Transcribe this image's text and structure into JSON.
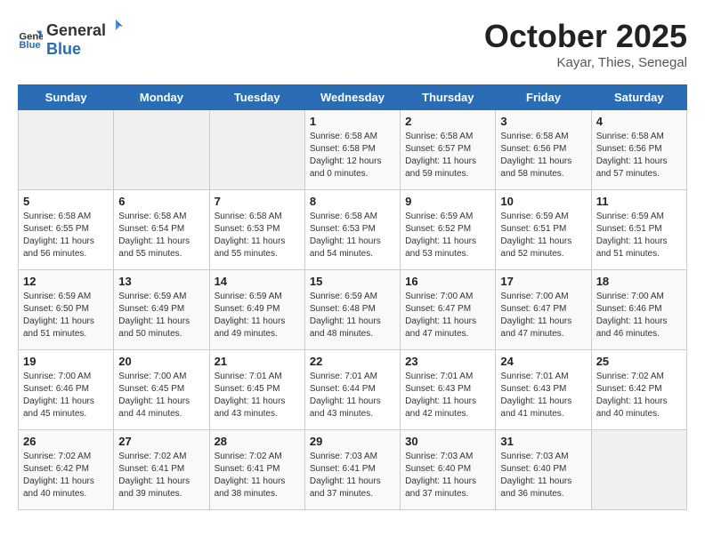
{
  "header": {
    "logo_general": "General",
    "logo_blue": "Blue",
    "title": "October 2025",
    "subtitle": "Kayar, Thies, Senegal"
  },
  "days_of_week": [
    "Sunday",
    "Monday",
    "Tuesday",
    "Wednesday",
    "Thursday",
    "Friday",
    "Saturday"
  ],
  "weeks": [
    [
      {
        "day": "",
        "empty": true
      },
      {
        "day": "",
        "empty": true
      },
      {
        "day": "",
        "empty": true
      },
      {
        "day": "1",
        "sunrise": "6:58 AM",
        "sunset": "6:58 PM",
        "daylight": "12 hours and 0 minutes."
      },
      {
        "day": "2",
        "sunrise": "6:58 AM",
        "sunset": "6:57 PM",
        "daylight": "11 hours and 59 minutes."
      },
      {
        "day": "3",
        "sunrise": "6:58 AM",
        "sunset": "6:56 PM",
        "daylight": "11 hours and 58 minutes."
      },
      {
        "day": "4",
        "sunrise": "6:58 AM",
        "sunset": "6:56 PM",
        "daylight": "11 hours and 57 minutes."
      }
    ],
    [
      {
        "day": "5",
        "sunrise": "6:58 AM",
        "sunset": "6:55 PM",
        "daylight": "11 hours and 56 minutes."
      },
      {
        "day": "6",
        "sunrise": "6:58 AM",
        "sunset": "6:54 PM",
        "daylight": "11 hours and 55 minutes."
      },
      {
        "day": "7",
        "sunrise": "6:58 AM",
        "sunset": "6:53 PM",
        "daylight": "11 hours and 55 minutes."
      },
      {
        "day": "8",
        "sunrise": "6:58 AM",
        "sunset": "6:53 PM",
        "daylight": "11 hours and 54 minutes."
      },
      {
        "day": "9",
        "sunrise": "6:59 AM",
        "sunset": "6:52 PM",
        "daylight": "11 hours and 53 minutes."
      },
      {
        "day": "10",
        "sunrise": "6:59 AM",
        "sunset": "6:51 PM",
        "daylight": "11 hours and 52 minutes."
      },
      {
        "day": "11",
        "sunrise": "6:59 AM",
        "sunset": "6:51 PM",
        "daylight": "11 hours and 51 minutes."
      }
    ],
    [
      {
        "day": "12",
        "sunrise": "6:59 AM",
        "sunset": "6:50 PM",
        "daylight": "11 hours and 51 minutes."
      },
      {
        "day": "13",
        "sunrise": "6:59 AM",
        "sunset": "6:49 PM",
        "daylight": "11 hours and 50 minutes."
      },
      {
        "day": "14",
        "sunrise": "6:59 AM",
        "sunset": "6:49 PM",
        "daylight": "11 hours and 49 minutes."
      },
      {
        "day": "15",
        "sunrise": "6:59 AM",
        "sunset": "6:48 PM",
        "daylight": "11 hours and 48 minutes."
      },
      {
        "day": "16",
        "sunrise": "7:00 AM",
        "sunset": "6:47 PM",
        "daylight": "11 hours and 47 minutes."
      },
      {
        "day": "17",
        "sunrise": "7:00 AM",
        "sunset": "6:47 PM",
        "daylight": "11 hours and 47 minutes."
      },
      {
        "day": "18",
        "sunrise": "7:00 AM",
        "sunset": "6:46 PM",
        "daylight": "11 hours and 46 minutes."
      }
    ],
    [
      {
        "day": "19",
        "sunrise": "7:00 AM",
        "sunset": "6:46 PM",
        "daylight": "11 hours and 45 minutes."
      },
      {
        "day": "20",
        "sunrise": "7:00 AM",
        "sunset": "6:45 PM",
        "daylight": "11 hours and 44 minutes."
      },
      {
        "day": "21",
        "sunrise": "7:01 AM",
        "sunset": "6:45 PM",
        "daylight": "11 hours and 43 minutes."
      },
      {
        "day": "22",
        "sunrise": "7:01 AM",
        "sunset": "6:44 PM",
        "daylight": "11 hours and 43 minutes."
      },
      {
        "day": "23",
        "sunrise": "7:01 AM",
        "sunset": "6:43 PM",
        "daylight": "11 hours and 42 minutes."
      },
      {
        "day": "24",
        "sunrise": "7:01 AM",
        "sunset": "6:43 PM",
        "daylight": "11 hours and 41 minutes."
      },
      {
        "day": "25",
        "sunrise": "7:02 AM",
        "sunset": "6:42 PM",
        "daylight": "11 hours and 40 minutes."
      }
    ],
    [
      {
        "day": "26",
        "sunrise": "7:02 AM",
        "sunset": "6:42 PM",
        "daylight": "11 hours and 40 minutes."
      },
      {
        "day": "27",
        "sunrise": "7:02 AM",
        "sunset": "6:41 PM",
        "daylight": "11 hours and 39 minutes."
      },
      {
        "day": "28",
        "sunrise": "7:02 AM",
        "sunset": "6:41 PM",
        "daylight": "11 hours and 38 minutes."
      },
      {
        "day": "29",
        "sunrise": "7:03 AM",
        "sunset": "6:41 PM",
        "daylight": "11 hours and 37 minutes."
      },
      {
        "day": "30",
        "sunrise": "7:03 AM",
        "sunset": "6:40 PM",
        "daylight": "11 hours and 37 minutes."
      },
      {
        "day": "31",
        "sunrise": "7:03 AM",
        "sunset": "6:40 PM",
        "daylight": "11 hours and 36 minutes."
      },
      {
        "day": "",
        "empty": true
      }
    ]
  ],
  "labels": {
    "sunrise": "Sunrise:",
    "sunset": "Sunset:",
    "daylight": "Daylight:"
  },
  "colors": {
    "header_bg": "#2a6db5",
    "logo_blue": "#2a6db5"
  }
}
